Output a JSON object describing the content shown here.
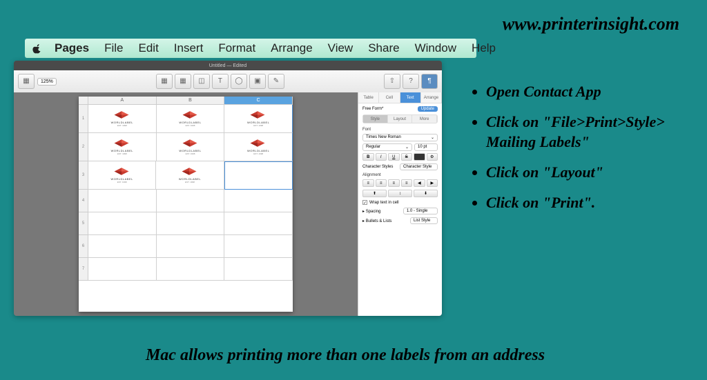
{
  "url": "www.printerinsight.com",
  "menu": {
    "app": "Pages",
    "items": [
      "File",
      "Edit",
      "Insert",
      "Format",
      "Arrange",
      "View",
      "Share",
      "Window",
      "Help"
    ]
  },
  "window": {
    "title": "Untitled — Edited",
    "zoom": "125%",
    "toolbar_groups": {
      "center": [
        "Insert",
        "Table",
        "Chart",
        "Text",
        "Shape",
        "Media",
        "Comment"
      ],
      "right": [
        "Share",
        "Tips",
        "Format"
      ]
    },
    "columns": [
      "A",
      "B",
      "C"
    ],
    "rows": [
      1,
      2,
      3,
      4,
      5,
      6,
      7
    ],
    "label": {
      "brand": "WORLDLABEL",
      "sub": "EST. 1998"
    },
    "selected_col": "C",
    "inspector": {
      "top_tabs": [
        "Table",
        "Cell",
        "Text",
        "Arrange"
      ],
      "active_top_tab": "Text",
      "style_name": "Free Form*",
      "update": "Update",
      "seg_tabs": [
        "Style",
        "Layout",
        "More"
      ],
      "active_seg": "Style",
      "font_label": "Font",
      "font_family": "Times New Roman",
      "font_style": "Regular",
      "font_size": "10 pt",
      "char_styles_label": "Character Styles",
      "char_styles_value": "Character Style",
      "alignment_label": "Alignment",
      "wrap_label": "Wrap text in cell",
      "spacing_label": "Spacing",
      "spacing_value": "1.0 - Single",
      "bullets_label": "Bullets & Lists",
      "bullets_value": "List Style"
    }
  },
  "instructions": [
    " Open Contact App",
    "Click on \"File>Print>Style> Mailing Labels\"",
    "Click on \"Layout\"",
    "Click on \"Print\"."
  ],
  "caption": "Mac allows printing  more than one labels from an address"
}
